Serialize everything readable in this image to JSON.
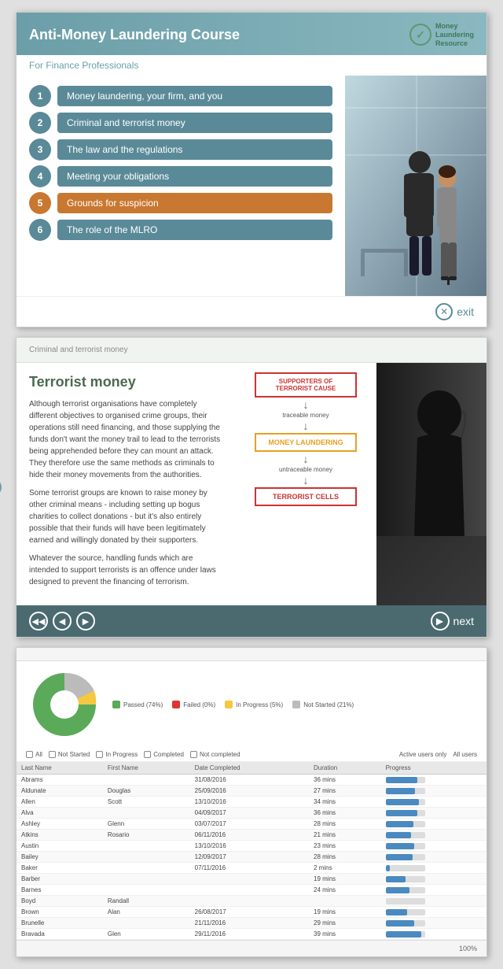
{
  "slide1": {
    "title": "Anti-Money Laundering Course",
    "subtitle": "For Finance Professionals",
    "logo_line1": "Money",
    "logo_line2": "Laundering",
    "logo_line3": "Resource",
    "menu_items": [
      {
        "num": "1",
        "label": "Money laundering, your firm, and you",
        "active": false
      },
      {
        "num": "2",
        "label": "Criminal and terrorist money",
        "active": false
      },
      {
        "num": "3",
        "label": "The law and the regulations",
        "active": false
      },
      {
        "num": "4",
        "label": "Meeting your obligations",
        "active": false
      },
      {
        "num": "5",
        "label": "Grounds for suspicion",
        "active": true
      },
      {
        "num": "6",
        "label": "The role of the MLRO",
        "active": false
      }
    ],
    "exit_label": "exit"
  },
  "slide2": {
    "header_text": "Criminal and terrorist money",
    "heading": "Terrorist money",
    "paragraphs": [
      "Although terrorist organisations have completely different objectives to organised crime groups, their operations still need financing, and those supplying the funds don't want the money trail to lead to the terrorists being apprehended before they can mount an attack. They therefore use the same methods as criminals to hide their money movements from the authorities.",
      "Some terrorist groups are known to raise money by other criminal means - including setting up bogus charities to collect donations - but it's also entirely possible that their funds will have been legitimately earned and willingly donated by their supporters.",
      "Whatever the source, handling funds which are intended to support terrorists is an offence under laws designed to prevent the financing of terrorism."
    ],
    "diagram": {
      "box1": "SUPPORTERS OF\nTERRORIST CAUSE",
      "label1": "traceable money",
      "box2": "MONEY LAUNDERING",
      "label2": "untraceable money",
      "box3": "TERRORIST CELLS"
    },
    "next_label": "next"
  },
  "slide3": {
    "header_text": "",
    "legend": [
      {
        "label": "Passed (74%)",
        "color": "#5aaa5a"
      },
      {
        "label": "Failed (0%)",
        "color": "#dd3333"
      },
      {
        "label": "In Progress (5%)",
        "color": "#f5c842"
      },
      {
        "label": "Not Started (21%)",
        "color": "#bbbbbb"
      }
    ],
    "filters": [
      "All",
      "Not Started",
      "In Progress",
      "Completed",
      "Not completed"
    ],
    "filter_right": [
      "Active users only",
      "All users"
    ],
    "columns": [
      "Last Name",
      "First Name",
      "Date Completed",
      "Duration",
      "Progress"
    ],
    "rows": [
      {
        "last": "Abrams",
        "first": "",
        "date": "31/08/2016",
        "dur": "36 mins",
        "prog": 80
      },
      {
        "last": "Aldunate",
        "first": "Douglas",
        "date": "25/09/2016",
        "dur": "27 mins",
        "prog": 75
      },
      {
        "last": "Allen",
        "first": "Scott",
        "date": "13/10/2016",
        "dur": "34 mins",
        "prog": 85
      },
      {
        "last": "Alva",
        "first": "",
        "date": "04/09/2017",
        "dur": "36 mins",
        "prog": 80
      },
      {
        "last": "Ashley",
        "first": "Glenn",
        "date": "03/07/2017",
        "dur": "28 mins",
        "prog": 70
      },
      {
        "last": "Atkins",
        "first": "Rosario",
        "date": "06/11/2016",
        "dur": "21 mins",
        "prog": 65
      },
      {
        "last": "Austin",
        "first": "",
        "date": "13/10/2016",
        "dur": "23 mins",
        "prog": 72
      },
      {
        "last": "Bailey",
        "first": "",
        "date": "12/09/2017",
        "dur": "28 mins",
        "prog": 68
      },
      {
        "last": "Baker",
        "first": "",
        "date": "07/11/2016",
        "dur": "2 mins",
        "prog": 10
      },
      {
        "last": "Barber",
        "first": "",
        "date": "",
        "dur": "19 mins",
        "prog": 50
      },
      {
        "last": "Barnes",
        "first": "",
        "date": "",
        "dur": "24 mins",
        "prog": 60
      },
      {
        "last": "Boyd",
        "first": "Randall",
        "date": "",
        "dur": "",
        "prog": 0
      },
      {
        "last": "Brown",
        "first": "Alan",
        "date": "26/08/2017",
        "dur": "19 mins",
        "prog": 55
      },
      {
        "last": "Brunelle",
        "first": "",
        "date": "21/11/2016",
        "dur": "29 mins",
        "prog": 73
      },
      {
        "last": "Bravada",
        "first": "Glen",
        "date": "29/11/2016",
        "dur": "39 mins",
        "prog": 90
      }
    ],
    "zoom_label": "100%"
  }
}
